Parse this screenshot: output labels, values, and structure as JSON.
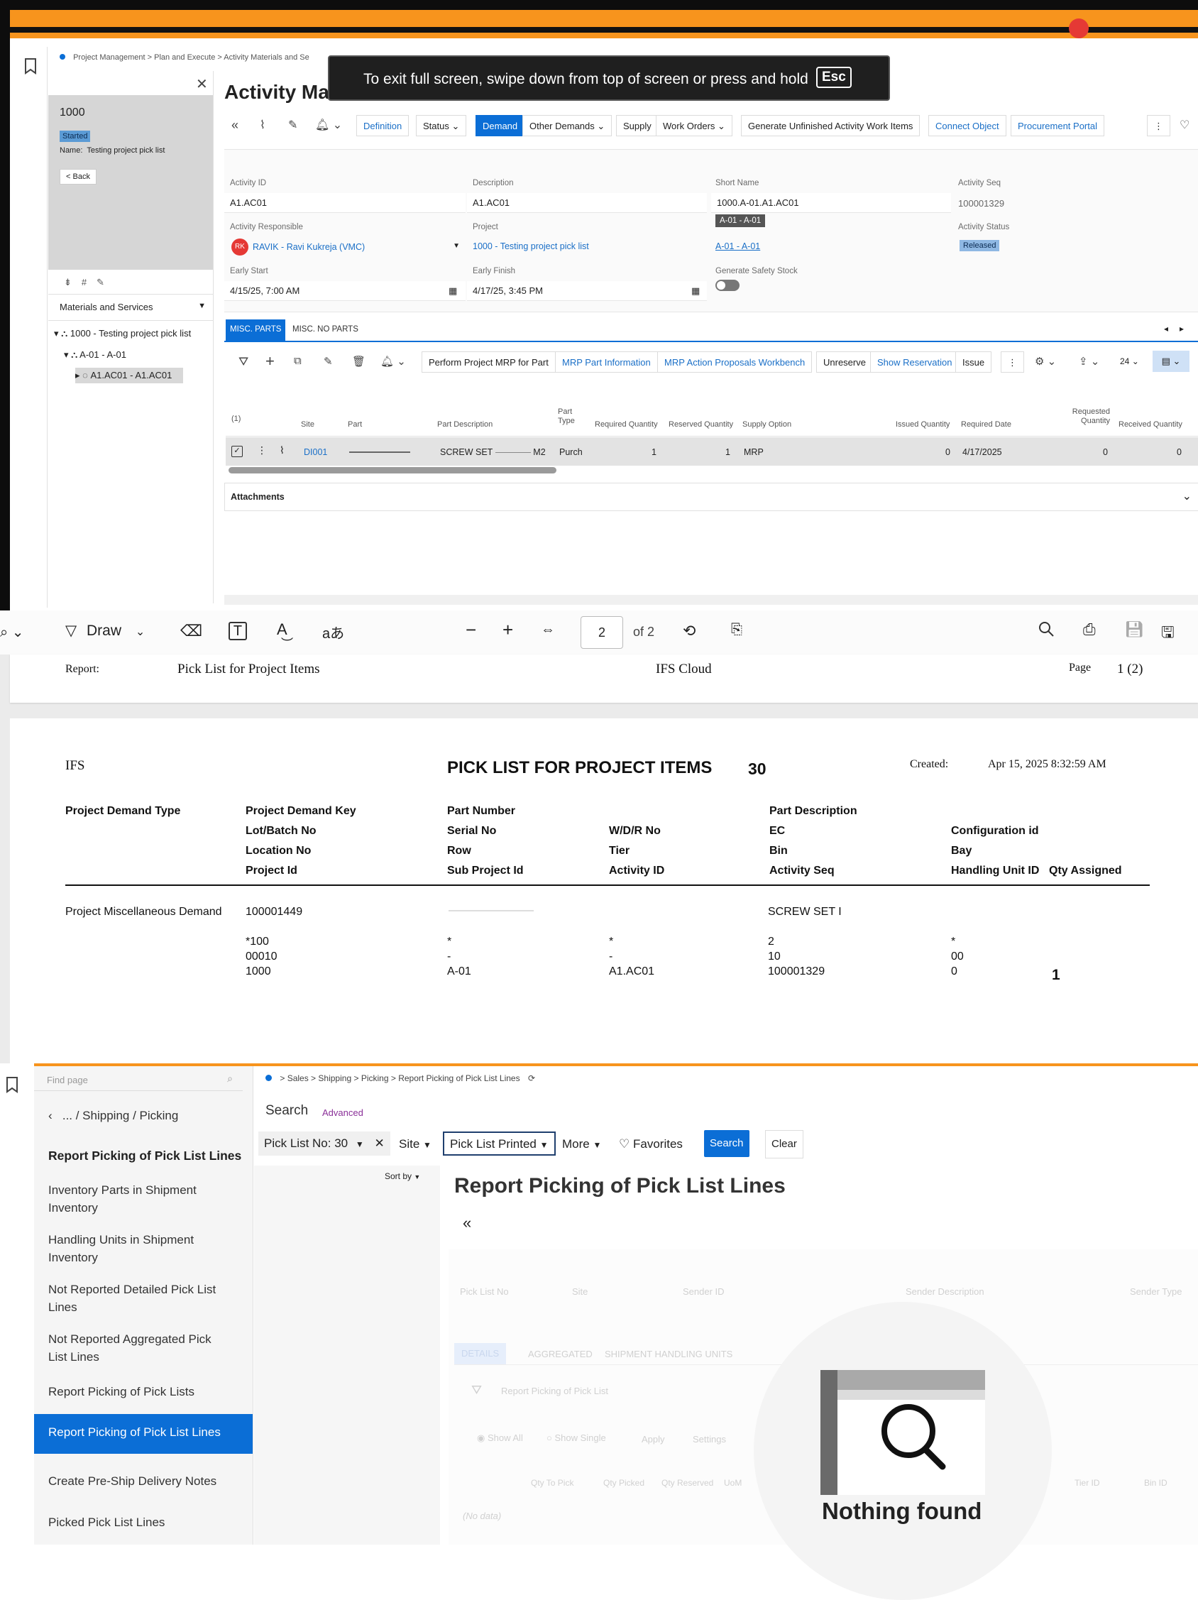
{
  "ifs_app": {
    "breadcrumb": [
      "Project Management",
      "Plan and Execute",
      "Activity Materials and Se"
    ],
    "fullscreen_toast": {
      "text": "To exit full screen, swipe down from top of screen or press and hold",
      "key": "Esc"
    },
    "page_title": "Activity Ma",
    "left_panel": {
      "record_id": "1000",
      "status": "Started",
      "name_label": "Name:",
      "name_value": "Testing project pick list",
      "back_label": "Back",
      "dropdown_label": "Materials and Services",
      "tree": [
        "1000 - Testing project pick list",
        "A-01 - A-01",
        "A1.AC01 - A1.AC01"
      ]
    },
    "toolbar": [
      "Definition",
      "Status",
      "Demand",
      "Other Demands",
      "Supply",
      "Work Orders",
      "Generate Unfinished Activity Work Items",
      "Connect Object",
      "Procurement Portal"
    ],
    "fields": {
      "activity_id": {
        "label": "Activity ID",
        "value": "A1.AC01"
      },
      "description": {
        "label": "Description",
        "value": "A1.AC01"
      },
      "short_name": {
        "label": "Short Name",
        "value": "1000.A-01.A1.AC01"
      },
      "activity_seq": {
        "label": "Activity Seq",
        "value": "100001329"
      },
      "activity_responsible": {
        "label": "Activity Responsible",
        "initials": "RK",
        "value": "RAVIK - Ravi Kukreja (VMC)"
      },
      "project": {
        "label": "Project",
        "value": "1000 - Testing project pick list"
      },
      "sub_project": {
        "tooltip": "A-01 - A-01",
        "value": "A-01 - A-01"
      },
      "activity_status": {
        "label": "Activity Status",
        "value": "Released"
      },
      "early_start": {
        "label": "Early Start",
        "value": "4/15/25, 7:00 AM"
      },
      "early_finish": {
        "label": "Early Finish",
        "value": "4/17/25, 3:45 PM"
      },
      "generate_safety_stock": {
        "label": "Generate Safety Stock"
      }
    },
    "tabs": [
      "MISC. PARTS",
      "MISC. NO PARTS"
    ],
    "grid_toolbar": [
      "Perform Project MRP for Part",
      "MRP Part Information",
      "MRP Action Proposals Workbench",
      "Unreserve",
      "Show Reservation",
      "Issue"
    ],
    "grid_page_size": "24",
    "grid": {
      "selected_count": "(1)",
      "columns": [
        "Site",
        "Part",
        "Part Description",
        "Part Type",
        "Required Quantity",
        "Reserved Quantity",
        "Supply Option",
        "Issued Quantity",
        "Required Date",
        "Requested Quantity",
        "Received Quantity"
      ],
      "row": {
        "site": "DI001",
        "part_description": "SCREW SET",
        "part_description_tail": "M2",
        "part_type": "Purch",
        "required_qty": "1",
        "reserved_qty": "1",
        "supply_option": "MRP",
        "issued_qty": "0",
        "required_date": "4/17/2025",
        "requested_qty": "0",
        "received_qty": "0"
      }
    },
    "attachments_label": "Attachments"
  },
  "pdf_viewer": {
    "draw_label": "Draw",
    "page_input": "2",
    "page_of": "of 2"
  },
  "report": {
    "header": {
      "report_label": "Report:",
      "report_name": "Pick List for Project Items",
      "system": "IFS Cloud",
      "page_label": "Page",
      "page_value": "1 (2)"
    },
    "company": "IFS",
    "title": "PICK LIST FOR PROJECT ITEMS",
    "pick_list_no": "30",
    "created_label": "Created:",
    "created_value": "Apr 15, 2025 8:32:59 AM",
    "headers": {
      "r1": [
        "Project Demand Type",
        "Project Demand Key",
        "Part Number",
        "Part Description"
      ],
      "r2": [
        "Lot/Batch No",
        "Serial No",
        "W/D/R No",
        "EC",
        "Configuration id"
      ],
      "r3": [
        "Location No",
        "Row",
        "Tier",
        "Bin",
        "Bay"
      ],
      "r4": [
        "Project Id",
        "Sub Project Id",
        "Activity ID",
        "Activity Seq",
        "Handling Unit ID",
        "Qty Assigned"
      ]
    },
    "row": {
      "demand_type": "Project Miscellaneous Demand",
      "demand_key": "100001449",
      "part_description": "SCREW SET I",
      "lot_batch": "*100",
      "serial": "*",
      "wdr": "*",
      "ec": "2",
      "config": "*",
      "location": "00010",
      "row_no": "-",
      "tier": "-",
      "bin": "10",
      "bay": "00",
      "project_id": "1000",
      "sub_project": "A-01",
      "activity_id": "A1.AC01",
      "activity_seq": "100001329",
      "hu_id": "0",
      "qty_assigned": "1"
    }
  },
  "ifs_shipping": {
    "find_placeholder": "Find page",
    "nav_back": "... / Shipping / Picking",
    "nav_heading": "Report Picking of Pick List Lines",
    "nav_items": [
      "Inventory Parts in Shipment Inventory",
      "Handling Units in Shipment Inventory",
      "Not Reported Detailed Pick List Lines",
      "Not Reported Aggregated Pick List Lines",
      "Report Picking of Pick Lists",
      "Report Picking of Pick List Lines",
      "Create Pre-Ship Delivery Notes",
      "Picked Pick List Lines"
    ],
    "active_nav": "Report Picking of Pick List Lines",
    "breadcrumb": [
      "Sales",
      "Shipping",
      "Picking",
      "Report Picking of Pick List Lines"
    ],
    "search_label": "Search",
    "advanced_label": "Advanced",
    "filters": {
      "pick_list": "Pick List No: 30",
      "site": "Site",
      "printed": "Pick List Printed",
      "more": "More",
      "favorites": "Favorites",
      "search": "Search",
      "clear": "Clear"
    },
    "sort_by": "Sort by",
    "page_title": "Report Picking of Pick List Lines",
    "ghost_columns": [
      "Pick List No",
      "Site",
      "Sender ID",
      "Sender Description",
      "Sender Type"
    ],
    "ghost_tabs": [
      "DETAILS",
      "AGGREGATED",
      "SHIPMENT HANDLING UNITS"
    ],
    "ghost_toolbar": "Report Picking of Pick List",
    "ghost_options": [
      "Show All",
      "Show Single",
      "Apply",
      "Settings"
    ],
    "ghost_grid_cols": [
      "Qty To Pick",
      "Qty Picked",
      "Qty Reserved",
      "UoM",
      "Tier ID",
      "Bin ID"
    ],
    "no_data": "(No data)",
    "nothing_found": "Nothing found"
  }
}
